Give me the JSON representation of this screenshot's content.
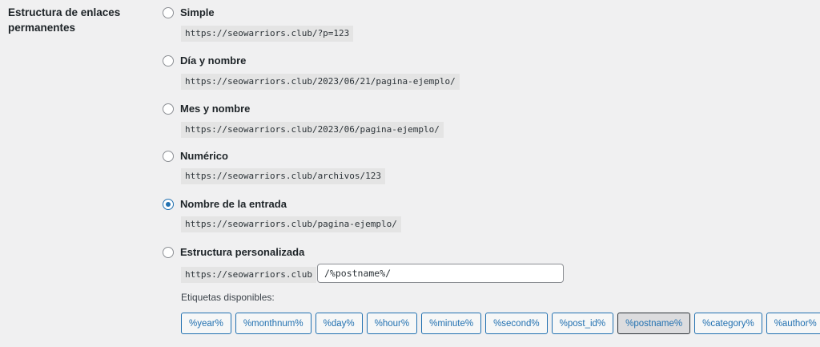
{
  "section_label": "Estructura de enlaces permanentes",
  "options": [
    {
      "label": "Simple",
      "example": "https://seowarriors.club/?p=123",
      "checked": false
    },
    {
      "label": "Día y nombre",
      "example": "https://seowarriors.club/2023/06/21/pagina-ejemplo/",
      "checked": false
    },
    {
      "label": "Mes y nombre",
      "example": "https://seowarriors.club/2023/06/pagina-ejemplo/",
      "checked": false
    },
    {
      "label": "Numérico",
      "example": "https://seowarriors.club/archivos/123",
      "checked": false
    },
    {
      "label": "Nombre de la entrada",
      "example": "https://seowarriors.club/pagina-ejemplo/",
      "checked": true
    },
    {
      "label": "Estructura personalizada",
      "example": "https://seowarriors.club",
      "checked": false
    }
  ],
  "custom_structure_value": "/%postname%/",
  "tags_label": "Etiquetas disponibles:",
  "tags": [
    {
      "label": "%year%",
      "active": false
    },
    {
      "label": "%monthnum%",
      "active": false
    },
    {
      "label": "%day%",
      "active": false
    },
    {
      "label": "%hour%",
      "active": false
    },
    {
      "label": "%minute%",
      "active": false
    },
    {
      "label": "%second%",
      "active": false
    },
    {
      "label": "%post_id%",
      "active": false
    },
    {
      "label": "%postname%",
      "active": true
    },
    {
      "label": "%category%",
      "active": false
    },
    {
      "label": "%author%",
      "active": false
    }
  ],
  "colors": {
    "accent": "#2271b1",
    "background": "#f0f0f1",
    "code_bg": "#e4e4e4"
  }
}
